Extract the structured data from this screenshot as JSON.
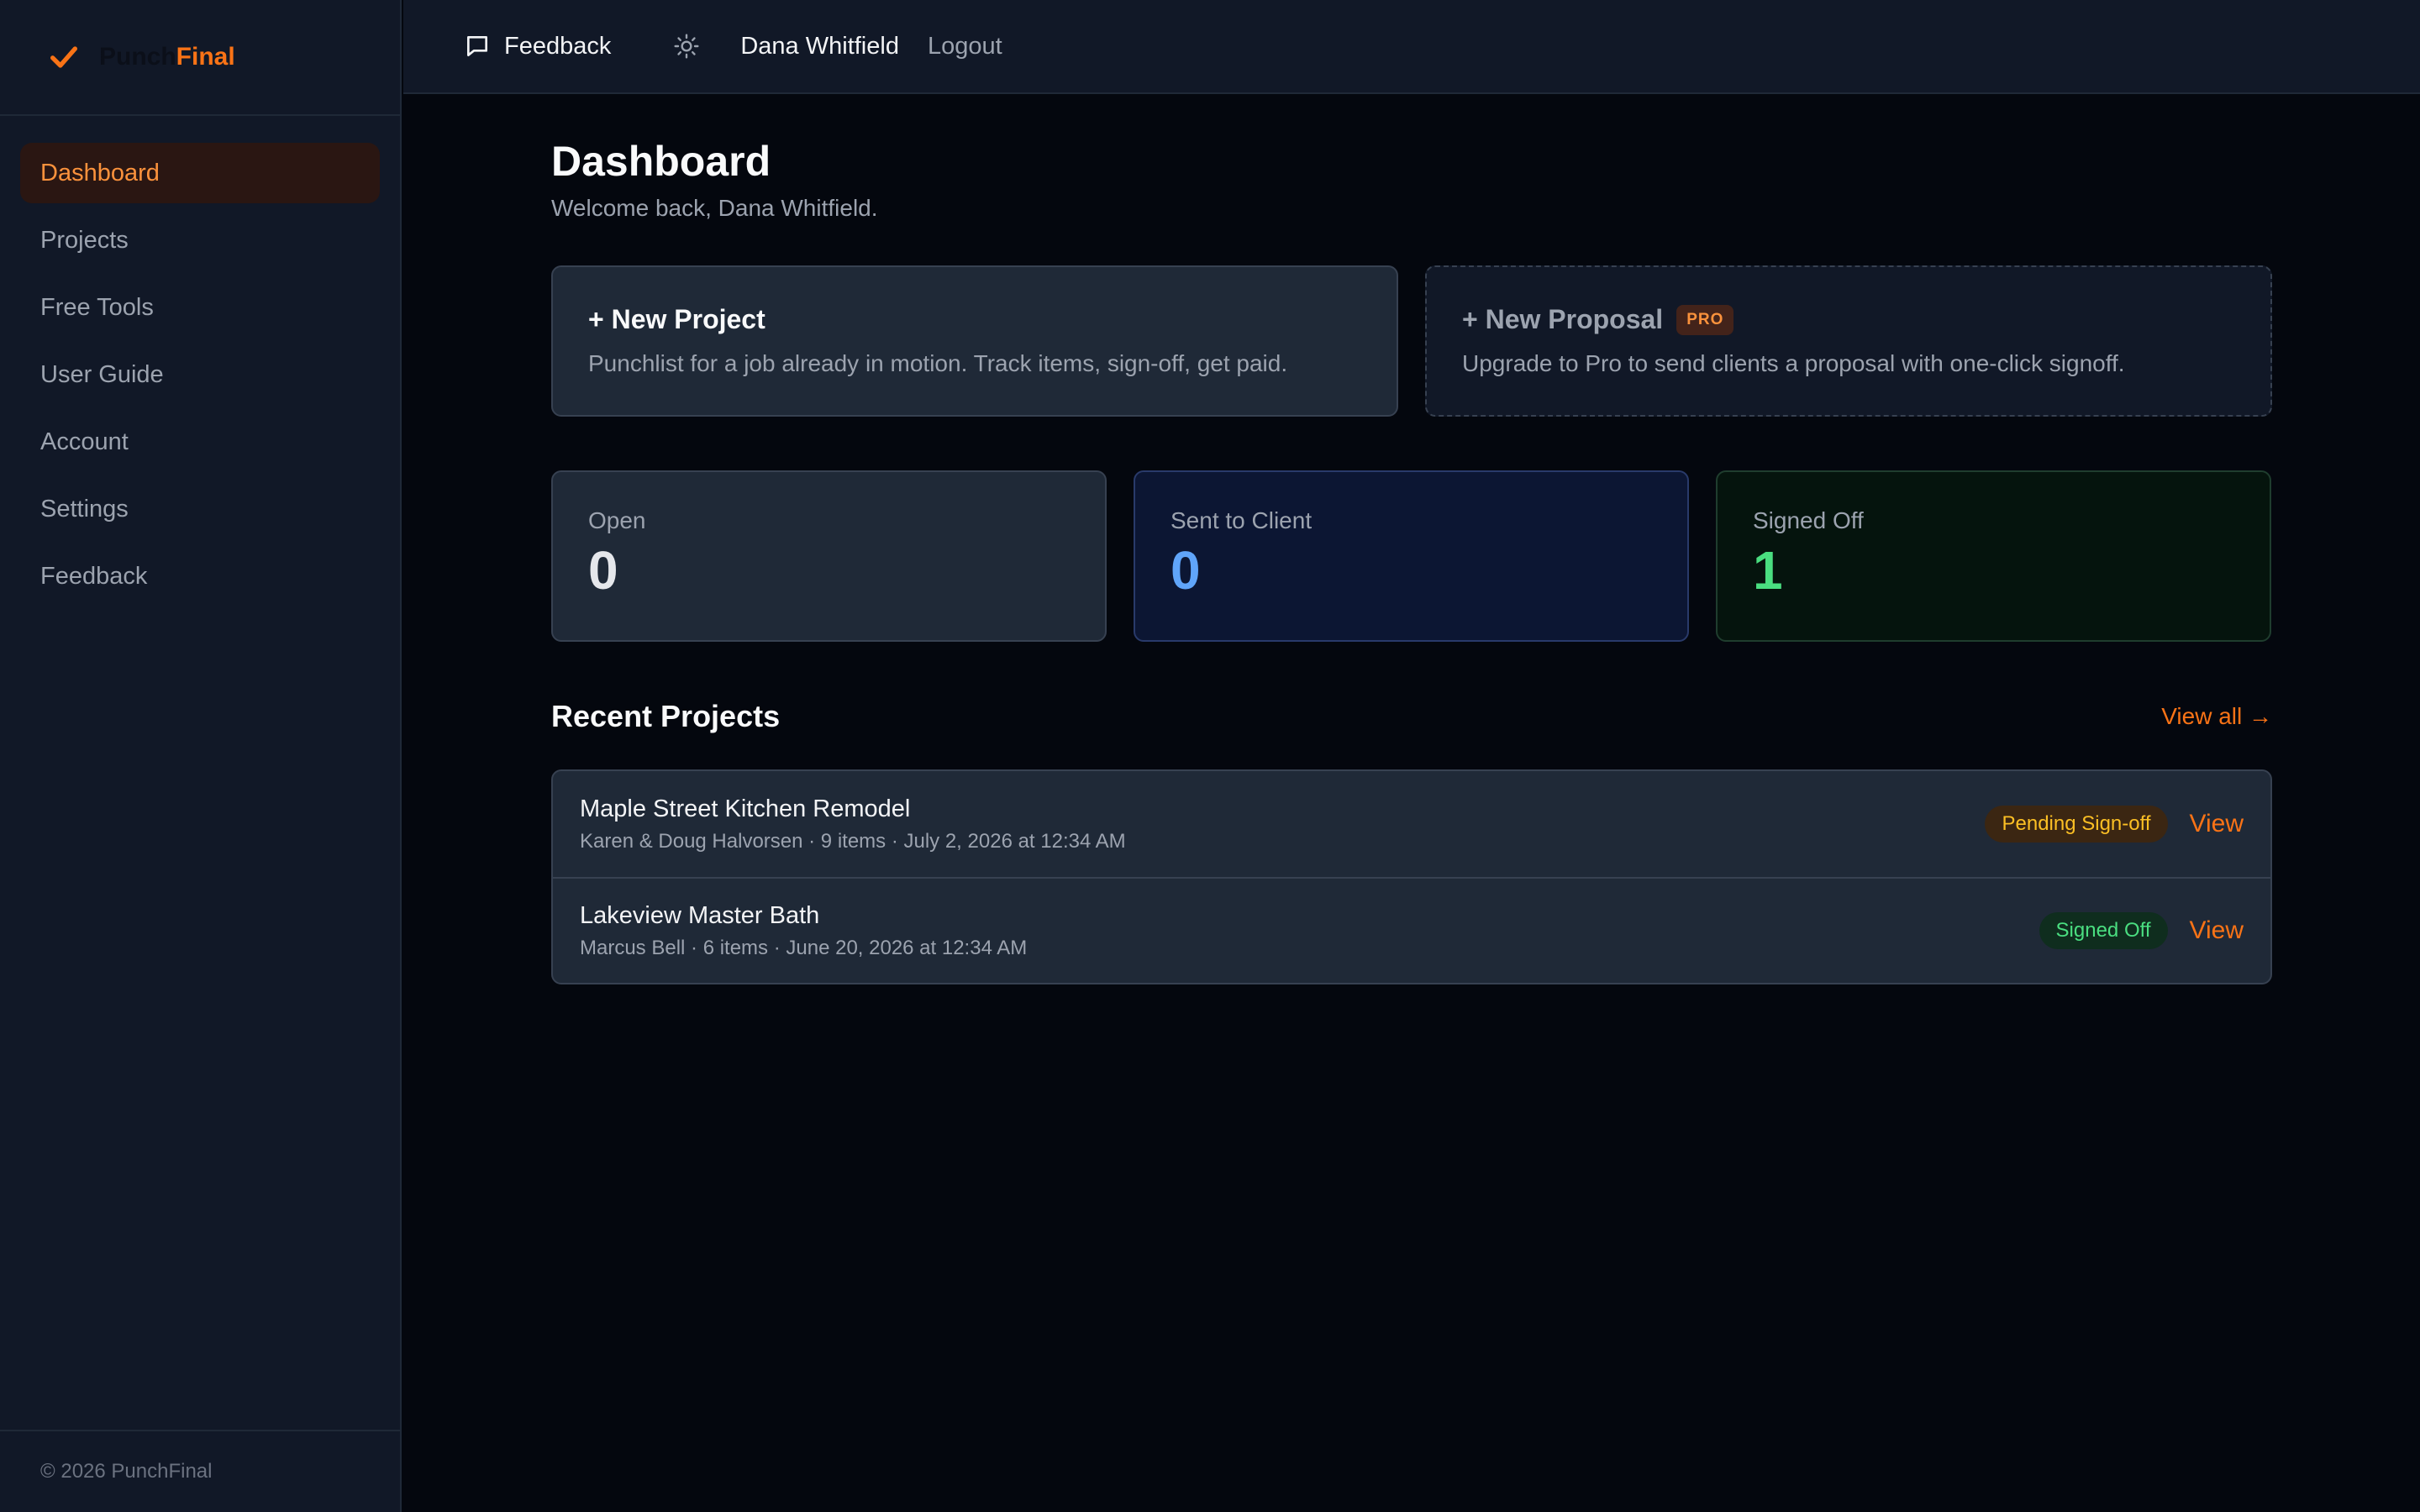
{
  "brand": {
    "part1": "Punch",
    "part2": "Final",
    "accent": "#f97316",
    "logo_icon": "checkmark-icon"
  },
  "sidebar": {
    "items": [
      {
        "label": "Dashboard",
        "active": true
      },
      {
        "label": "Projects"
      },
      {
        "label": "Free Tools"
      },
      {
        "label": "User Guide"
      },
      {
        "label": "Account"
      },
      {
        "label": "Settings"
      },
      {
        "label": "Feedback"
      }
    ],
    "footer": "© 2026 PunchFinal"
  },
  "topbar": {
    "feedback_label": "Feedback",
    "feedback_icon": "message-square-icon",
    "theme_icon": "sun-icon",
    "user_name": "Dana Whitfield",
    "logout_label": "Logout"
  },
  "page": {
    "title": "Dashboard",
    "welcome": "Welcome back, Dana Whitfield."
  },
  "actions": {
    "new_project": {
      "title": "+ New Project",
      "description": "Punchlist for a job already in motion. Track items, sign-off, get paid."
    },
    "new_proposal": {
      "title": "+ New Proposal",
      "badge": "PRO",
      "description": "Upgrade to Pro to send clients a proposal with one-click signoff."
    }
  },
  "stats": {
    "open": {
      "label": "Open",
      "value": "0"
    },
    "sent": {
      "label": "Sent to Client",
      "value": "0"
    },
    "signed": {
      "label": "Signed Off",
      "value": "1"
    }
  },
  "recent": {
    "title": "Recent Projects",
    "view_all": "View all →",
    "projects": [
      {
        "name": "Maple Street Kitchen Remodel",
        "meta": "Karen & Doug Halvorsen · 9 items · July 2, 2026 at 12:34 AM",
        "status": "Pending Sign-off",
        "view": "View"
      },
      {
        "name": "Lakeview Master Bath",
        "meta": "Marcus Bell · 6 items · June 20, 2026 at 12:34 AM",
        "status": "Signed Off",
        "view": "View"
      }
    ]
  }
}
